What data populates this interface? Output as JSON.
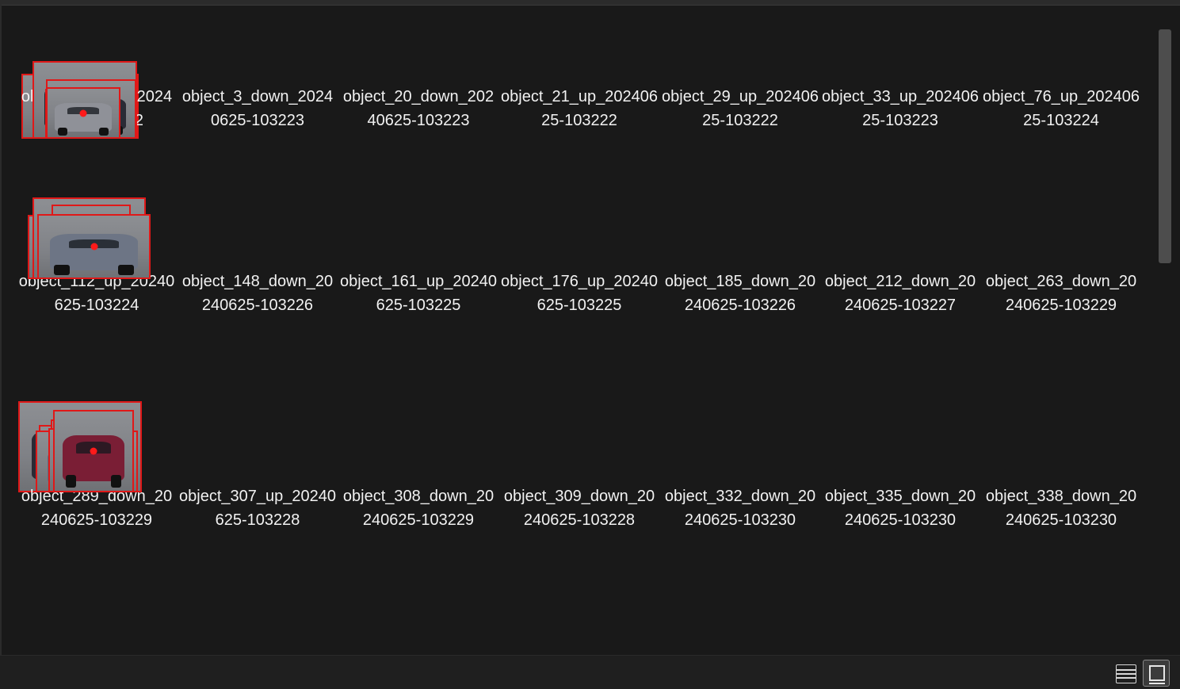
{
  "window": {
    "bottom_bar": {
      "view_buttons": [
        {
          "name": "details-view-button",
          "icon": "list-view-icon",
          "selected": false
        },
        {
          "name": "large-icons-view-button",
          "icon": "large-icons-view-icon",
          "selected": true
        }
      ]
    }
  },
  "files": [
    {
      "name": "object_1_down_20240625-103222",
      "thumb_color": "#3a3c4a"
    },
    {
      "name": "object_3_down_20240625-103223",
      "thumb_color": "#9a9ca2"
    },
    {
      "name": "object_20_down_20240625-103223",
      "thumb_color": "#22252e"
    },
    {
      "name": "object_21_up_20240625-103222",
      "thumb_color": "#6b1f26"
    },
    {
      "name": "object_29_up_20240625-103222",
      "thumb_color": "#b9babd"
    },
    {
      "name": "object_33_up_20240625-103223",
      "thumb_color": "#2a2b35"
    },
    {
      "name": "object_76_up_20240625-103224",
      "thumb_color": "#8f9198"
    },
    {
      "name": "object_112_up_20240625-103224",
      "thumb_color": "#b3b4b8"
    },
    {
      "name": "object_148_down_20240625-103226",
      "thumb_color": "#bfc0c3"
    },
    {
      "name": "object_161_up_20240625-103225",
      "thumb_color": "#1e1f27"
    },
    {
      "name": "object_176_up_20240625-103225",
      "thumb_color": "#23252e"
    },
    {
      "name": "object_185_down_20240625-103226",
      "thumb_color": "#b7b6b2"
    },
    {
      "name": "object_212_down_20240625-103227",
      "thumb_color": "#2e3038"
    },
    {
      "name": "object_263_down_20240625-103229",
      "thumb_color": "#6d7585"
    },
    {
      "name": "object_289_down_20240625-103229",
      "thumb_color": "#2a2a35"
    },
    {
      "name": "object_307_up_20240625-103228",
      "thumb_color": "#e6e6e6"
    },
    {
      "name": "object_308_down_20240625-103229",
      "thumb_color": "#e8e8e8"
    },
    {
      "name": "object_309_down_20240625-103228",
      "thumb_color": "#5e6b7d"
    },
    {
      "name": "object_332_down_20240625-103230",
      "thumb_color": "#2b3045"
    },
    {
      "name": "object_335_down_20240625-103230",
      "thumb_color": "#363b52"
    },
    {
      "name": "object_338_down_20240625-103230",
      "thumb_color": "#7a1e35"
    }
  ]
}
